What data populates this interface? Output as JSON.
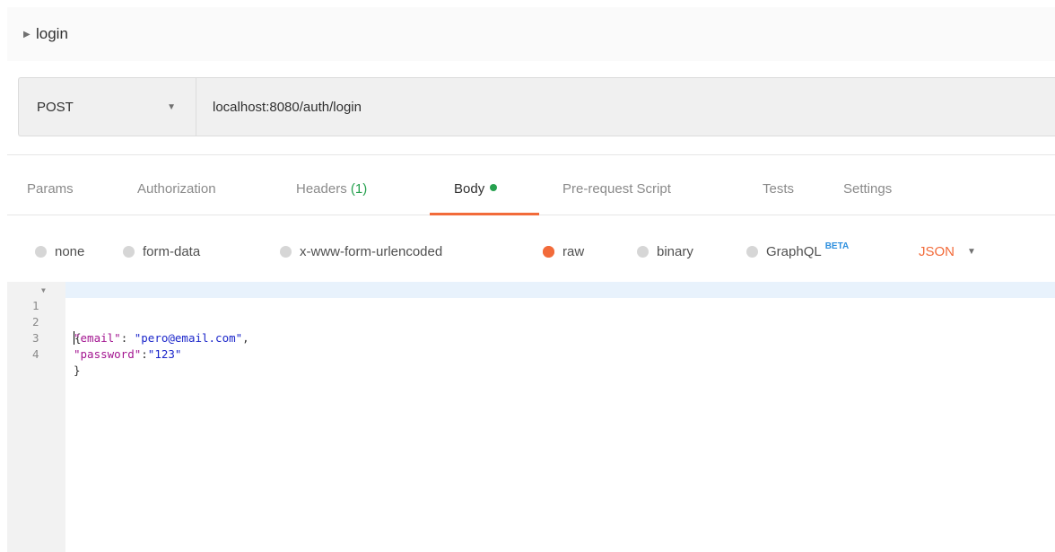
{
  "request": {
    "name": "login",
    "method": "POST",
    "url": "localhost:8080/auth/login"
  },
  "tabs": {
    "params": "Params",
    "authorization": "Authorization",
    "headers": "Headers",
    "headers_count": "(1)",
    "body": "Body",
    "prerequest": "Pre-request Script",
    "tests": "Tests",
    "settings": "Settings",
    "active": "Body"
  },
  "body_types": {
    "none": "none",
    "form_data": "form-data",
    "urlencoded": "x-www-form-urlencoded",
    "raw": "raw",
    "binary": "binary",
    "graphql": "GraphQL",
    "graphql_badge": "BETA",
    "selected": "raw",
    "format": "JSON"
  },
  "editor": {
    "lines": [
      {
        "number": "1",
        "text": "{"
      },
      {
        "number": "2",
        "key": "\"email\"",
        "sep": ": ",
        "value": "\"pero@email.com\"",
        "tail": ","
      },
      {
        "number": "3",
        "key": "\"password\"",
        "sep": ":",
        "value": "\"123\"",
        "tail": ""
      },
      {
        "number": "4",
        "text": "}"
      }
    ]
  },
  "colors": {
    "accent": "#f26b3a",
    "success": "#26a14f",
    "beta": "#2e8fde",
    "json_key": "#a31590",
    "json_string": "#1b26ca"
  },
  "icons": {
    "title_caret": "caret-right-icon",
    "method_dropdown": "chevron-down-icon",
    "format_dropdown": "chevron-down-icon",
    "fold": "fold-arrow-icon"
  }
}
